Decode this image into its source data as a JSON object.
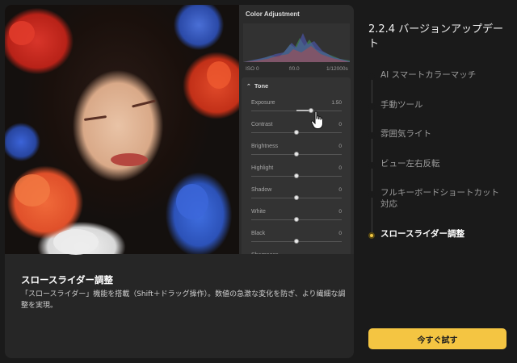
{
  "panel": {
    "title": "Color Adjustment",
    "histogram_readout": {
      "iso": "ISO 0",
      "aperture": "f/0.0",
      "shutter": "1/12000s"
    },
    "section": "Tone",
    "sliders": [
      {
        "label": "Exposure",
        "value": "1.50",
        "position": 0.66
      },
      {
        "label": "Contrast",
        "value": "0",
        "position": 0.5
      },
      {
        "label": "Brightness",
        "value": "0",
        "position": 0.5
      },
      {
        "label": "Highlight",
        "value": "0",
        "position": 0.5
      },
      {
        "label": "Shadow",
        "value": "0",
        "position": 0.5
      },
      {
        "label": "White",
        "value": "0",
        "position": 0.5
      },
      {
        "label": "Black",
        "value": "0",
        "position": 0.5
      },
      {
        "label": "Sharpness",
        "value": "",
        "position": 0.5
      }
    ]
  },
  "caption": {
    "title": "スロースライダー調整",
    "body": "「スロースライダー」機能を搭載（Shift＋ドラッグ操作）。数値の急激な変化を防ぎ、より繊細な調整を実現。"
  },
  "sidebar": {
    "title": "2.2.4 バージョンアップデート",
    "items": [
      {
        "label": "AI スマートカラーマッチ",
        "active": false
      },
      {
        "label": "手動ツール",
        "active": false
      },
      {
        "label": "雰囲気ライト",
        "active": false
      },
      {
        "label": "ビュー左右反転",
        "active": false
      },
      {
        "label": "フルキーボードショートカット対応",
        "active": false
      },
      {
        "label": "スロースライダー調整",
        "active": true
      }
    ],
    "cta": "今すぐ試す"
  },
  "colors": {
    "accent": "#f4c542",
    "background": "#1a1a1a",
    "card": "#262626"
  }
}
